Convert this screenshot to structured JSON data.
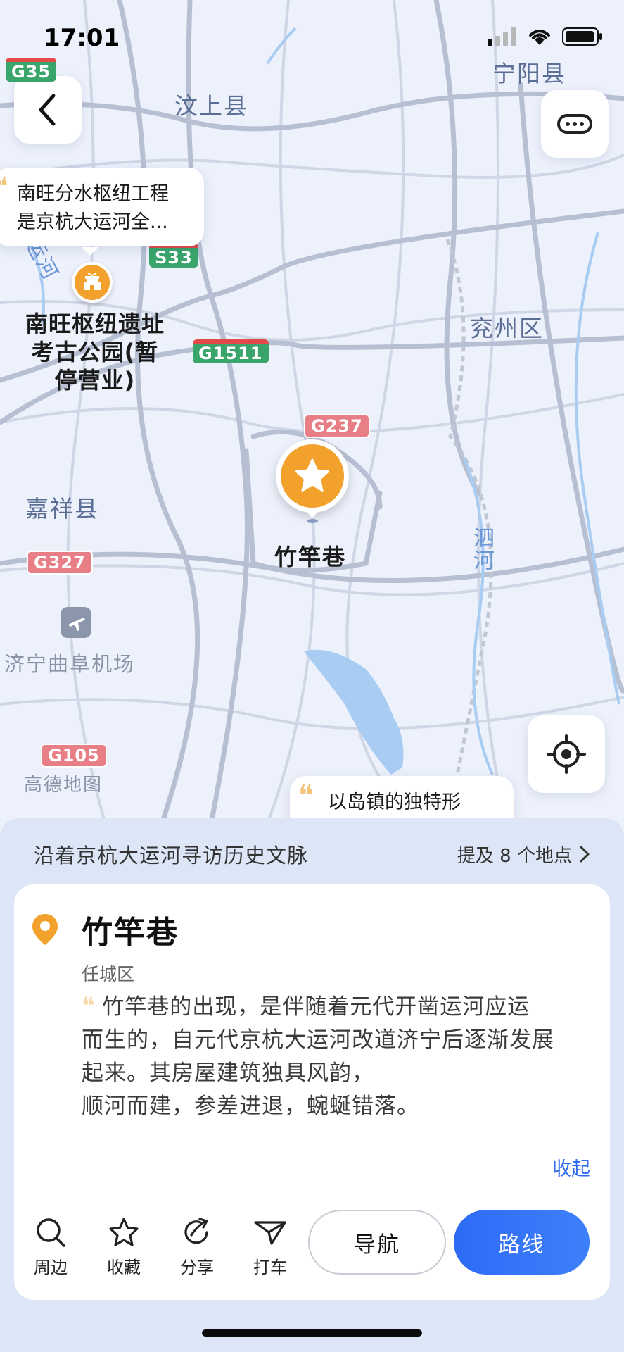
{
  "status_bar": {
    "time": "17:01"
  },
  "map": {
    "places": {
      "wenshang": "汶上县",
      "ningyang": "宁阳县",
      "yanzhou": "兖州区",
      "jiaxiang": "嘉祥县",
      "sihe": "泗河",
      "he_left": "运河",
      "airport": "济宁曲阜机场",
      "logo": "高德地图"
    },
    "road_shields": {
      "g35": "G35",
      "s33": "S33",
      "g1511": "G1511",
      "g237": "G237",
      "g327": "G327",
      "g105": "G105"
    },
    "poi": {
      "name": "南旺枢纽遗址考古公园(暂停营业)",
      "line1": "南旺枢纽遗址",
      "line2": "考古公园(暂",
      "line3": "停营业)",
      "icon": "castle-gate-icon"
    },
    "bubble_top": {
      "line1": "南旺分水枢纽工程",
      "line2": "是京杭大运河全..."
    },
    "bubble_bottom": {
      "text": "以岛镇的独特形"
    },
    "selected": {
      "label": "竹竿巷",
      "icon": "star-icon"
    }
  },
  "sheet": {
    "route_title": "沿着京杭大运河寻访历史文脉",
    "route_more": "提及 8 个地点",
    "card": {
      "title": "竹竿巷",
      "district": "任城区",
      "desc_line1": "竹竿巷的出现，是伴随着元代开凿运河应运",
      "desc_line2": "而生的，自元代京杭大运河改道济宁后逐渐发展",
      "desc_line3": "起来。其房屋建筑独具风韵，",
      "desc_line4": "顺河而建，参差进退，蜿蜒错落。",
      "collapse": "收起"
    },
    "tools": [
      {
        "label": "周边",
        "icon": "search-icon"
      },
      {
        "label": "收藏",
        "icon": "star-outline-icon"
      },
      {
        "label": "分享",
        "icon": "share-icon"
      },
      {
        "label": "打车",
        "icon": "taxi-icon"
      }
    ],
    "nav_button": "导航",
    "route_button": "路线"
  },
  "colors": {
    "accent_blue": "#2e6bf6",
    "poi_orange": "#f1a12c",
    "map_bg": "#edf1fb",
    "road_gray": "#b7c0d2",
    "water_blue": "#a9ccf3"
  }
}
